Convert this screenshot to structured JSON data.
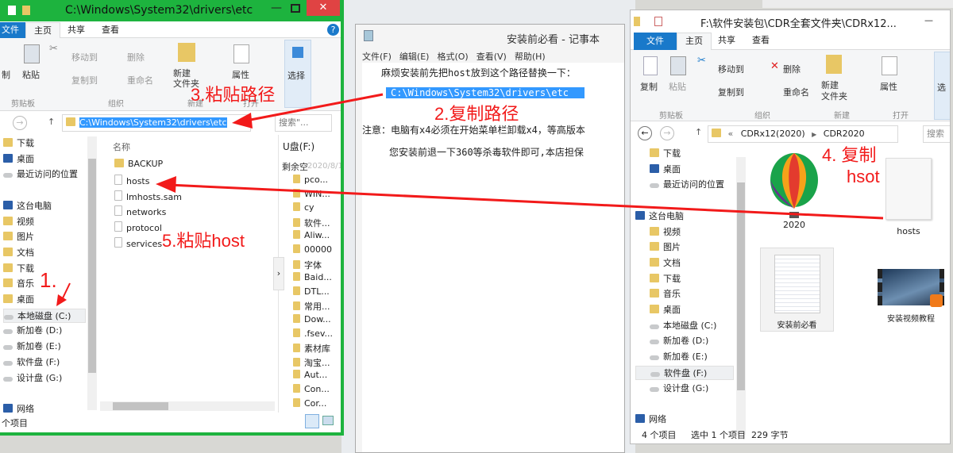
{
  "left_explorer": {
    "title": "C:\\Windows\\System32\\drivers\\etc",
    "tabs": [
      "文件",
      "主页",
      "共享",
      "查看"
    ],
    "ribbon": {
      "copy": "制",
      "paste": "粘贴",
      "move_to": "移动到",
      "copy_to": "复制到",
      "delete": "删除",
      "rename": "重命名",
      "new_folder": "新建\n文件夹",
      "properties": "属性",
      "select": "选择",
      "groups": [
        "剪贴板",
        "组织",
        "新建",
        "打开"
      ]
    },
    "address": "C:\\Windows\\System32\\drivers\\etc",
    "search_placeholder": "搜索\"...",
    "column_name": "名称",
    "nav": [
      {
        "label": "下载",
        "type": "folder"
      },
      {
        "label": "桌面",
        "type": "pc"
      },
      {
        "label": "最近访问的位置",
        "type": "drive"
      },
      {
        "label": "",
        "type": "gap"
      },
      {
        "label": "这台电脑",
        "type": "pc",
        "root": true
      },
      {
        "label": "视频",
        "type": "folder"
      },
      {
        "label": "图片",
        "type": "folder"
      },
      {
        "label": "文档",
        "type": "folder"
      },
      {
        "label": "下载",
        "type": "folder"
      },
      {
        "label": "音乐",
        "type": "folder"
      },
      {
        "label": "桌面",
        "type": "folder"
      },
      {
        "label": "本地磁盘 (C:)",
        "type": "drive",
        "selected": true
      },
      {
        "label": "新加卷 (D:)",
        "type": "drive"
      },
      {
        "label": "新加卷 (E:)",
        "type": "drive"
      },
      {
        "label": "软件盘 (F:)",
        "type": "drive"
      },
      {
        "label": "设计盘 (G:)",
        "type": "drive"
      },
      {
        "label": "",
        "type": "gap"
      },
      {
        "label": "网络",
        "type": "pc",
        "root": true
      }
    ],
    "files": [
      {
        "name": "BACKUP",
        "type": "folder"
      },
      {
        "name": "hosts",
        "type": "file"
      },
      {
        "name": "lmhosts.sam",
        "type": "file"
      },
      {
        "name": "networks",
        "type": "file"
      },
      {
        "name": "protocol",
        "type": "file"
      },
      {
        "name": "services",
        "type": "file"
      }
    ],
    "status": "个项目",
    "preview_pane": {
      "drive": "U盘(F:)",
      "header": "剩余空",
      "date": "2020/8/1",
      "items": [
        "pco...",
        "WIN...",
        "cy",
        "软件...",
        "Aliw...",
        "00000",
        "字体",
        "Baid...",
        "DTL...",
        "常用...",
        "Dow...",
        ".fsev...",
        "素材库",
        "淘宝...",
        "Aut...",
        "Con...",
        "Cor..."
      ]
    }
  },
  "notepad": {
    "title": "安装前必看 - 记事本",
    "menu": [
      "文件(F)",
      "编辑(E)",
      "格式(O)",
      "查看(V)",
      "帮助(H)"
    ],
    "lines": [
      "　　麻烦安装前先把host放到这个路径替换一下：",
      "C:\\Windows\\System32\\drivers\\etc",
      "注意：电脑有x4必须在开始菜单栏卸载x4，等高版本",
      "　　您安装前退一下360等杀毒软件即可,本店担保"
    ]
  },
  "right_explorer": {
    "title": "F:\\软件安装包\\CDR全套文件夹\\CDRx12...",
    "tabs": [
      "文件",
      "主页",
      "共享",
      "查看"
    ],
    "ribbon": {
      "copy": "复制",
      "paste": "粘贴",
      "move_to": "移动到",
      "copy_to": "复制到",
      "delete": "删除",
      "rename": "重命名",
      "new_folder": "新建\n文件夹",
      "properties": "属性",
      "select": "选",
      "groups": [
        "剪贴板",
        "组织",
        "新建",
        "打开"
      ]
    },
    "breadcrumb": [
      "«",
      "CDRx12(2020)",
      "CDR2020"
    ],
    "search_placeholder": "搜索",
    "nav": [
      {
        "label": "下载",
        "type": "folder"
      },
      {
        "label": "桌面",
        "type": "pc"
      },
      {
        "label": "最近访问的位置",
        "type": "drive"
      },
      {
        "label": "",
        "type": "gap"
      },
      {
        "label": "这台电脑",
        "type": "pc",
        "root": true
      },
      {
        "label": "视频",
        "type": "folder"
      },
      {
        "label": "图片",
        "type": "folder"
      },
      {
        "label": "文档",
        "type": "folder"
      },
      {
        "label": "下载",
        "type": "folder"
      },
      {
        "label": "音乐",
        "type": "folder"
      },
      {
        "label": "桌面",
        "type": "folder"
      },
      {
        "label": "本地磁盘 (C:)",
        "type": "drive"
      },
      {
        "label": "新加卷 (D:)",
        "type": "drive"
      },
      {
        "label": "新加卷 (E:)",
        "type": "drive"
      },
      {
        "label": "软件盘 (F:)",
        "type": "drive",
        "selected": true
      },
      {
        "label": "设计盘 (G:)",
        "type": "drive"
      },
      {
        "label": "",
        "type": "gap"
      },
      {
        "label": "网络",
        "type": "pc",
        "root": true
      }
    ],
    "items": [
      {
        "name": "2020",
        "type": "balloon"
      },
      {
        "name": "hosts",
        "type": "file"
      },
      {
        "name": "安装前必看",
        "type": "text",
        "selected": true
      },
      {
        "name": "安装视频教程",
        "type": "video"
      }
    ],
    "status": {
      "count": "4 个项目",
      "selection": "选中 1 个项目",
      "size": "229 字节"
    }
  },
  "annotations": {
    "step1": "1.",
    "step2": "2.复制路径",
    "step3": "3.粘贴路径",
    "step4a": "4. 复制",
    "step4b": "hsot",
    "step5": "5.粘贴host"
  },
  "colors": {
    "highlight_border": "#1db33e",
    "annotation": "#f21a1a",
    "file_tab": "#1979ca",
    "selection": "#3399ff",
    "close": "#e04343"
  }
}
